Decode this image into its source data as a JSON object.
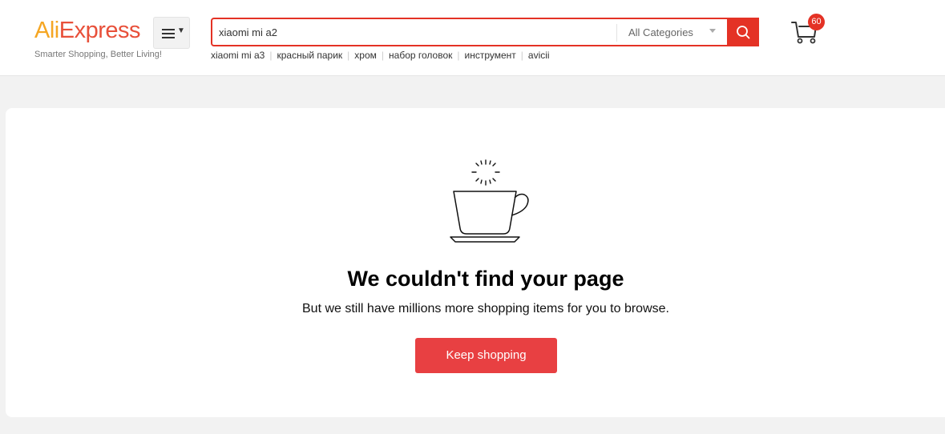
{
  "logo": {
    "part1": "Ali",
    "part2": "Express",
    "tagline": "Smarter Shopping, Better Living!"
  },
  "header": {
    "menu_icon": "hamburger-menu-icon"
  },
  "search": {
    "value": "xiaomi mi a2",
    "category": "All Categories",
    "button_icon": "search-icon",
    "suggestions": [
      "xiaomi mi a3",
      "красный парик",
      "хром",
      "набор головок",
      "инструмент",
      "avicii"
    ]
  },
  "cart": {
    "count": "60",
    "icon": "cart-icon"
  },
  "error": {
    "illustration": "coffee-cup-icon",
    "title": "We couldn't find your page",
    "subtitle": "But we still have millions more shopping items for you to browse.",
    "button": "Keep shopping"
  },
  "colors": {
    "brand_red": "#e43225",
    "brand_orange": "#f5a623",
    "button_red": "#e84042"
  }
}
